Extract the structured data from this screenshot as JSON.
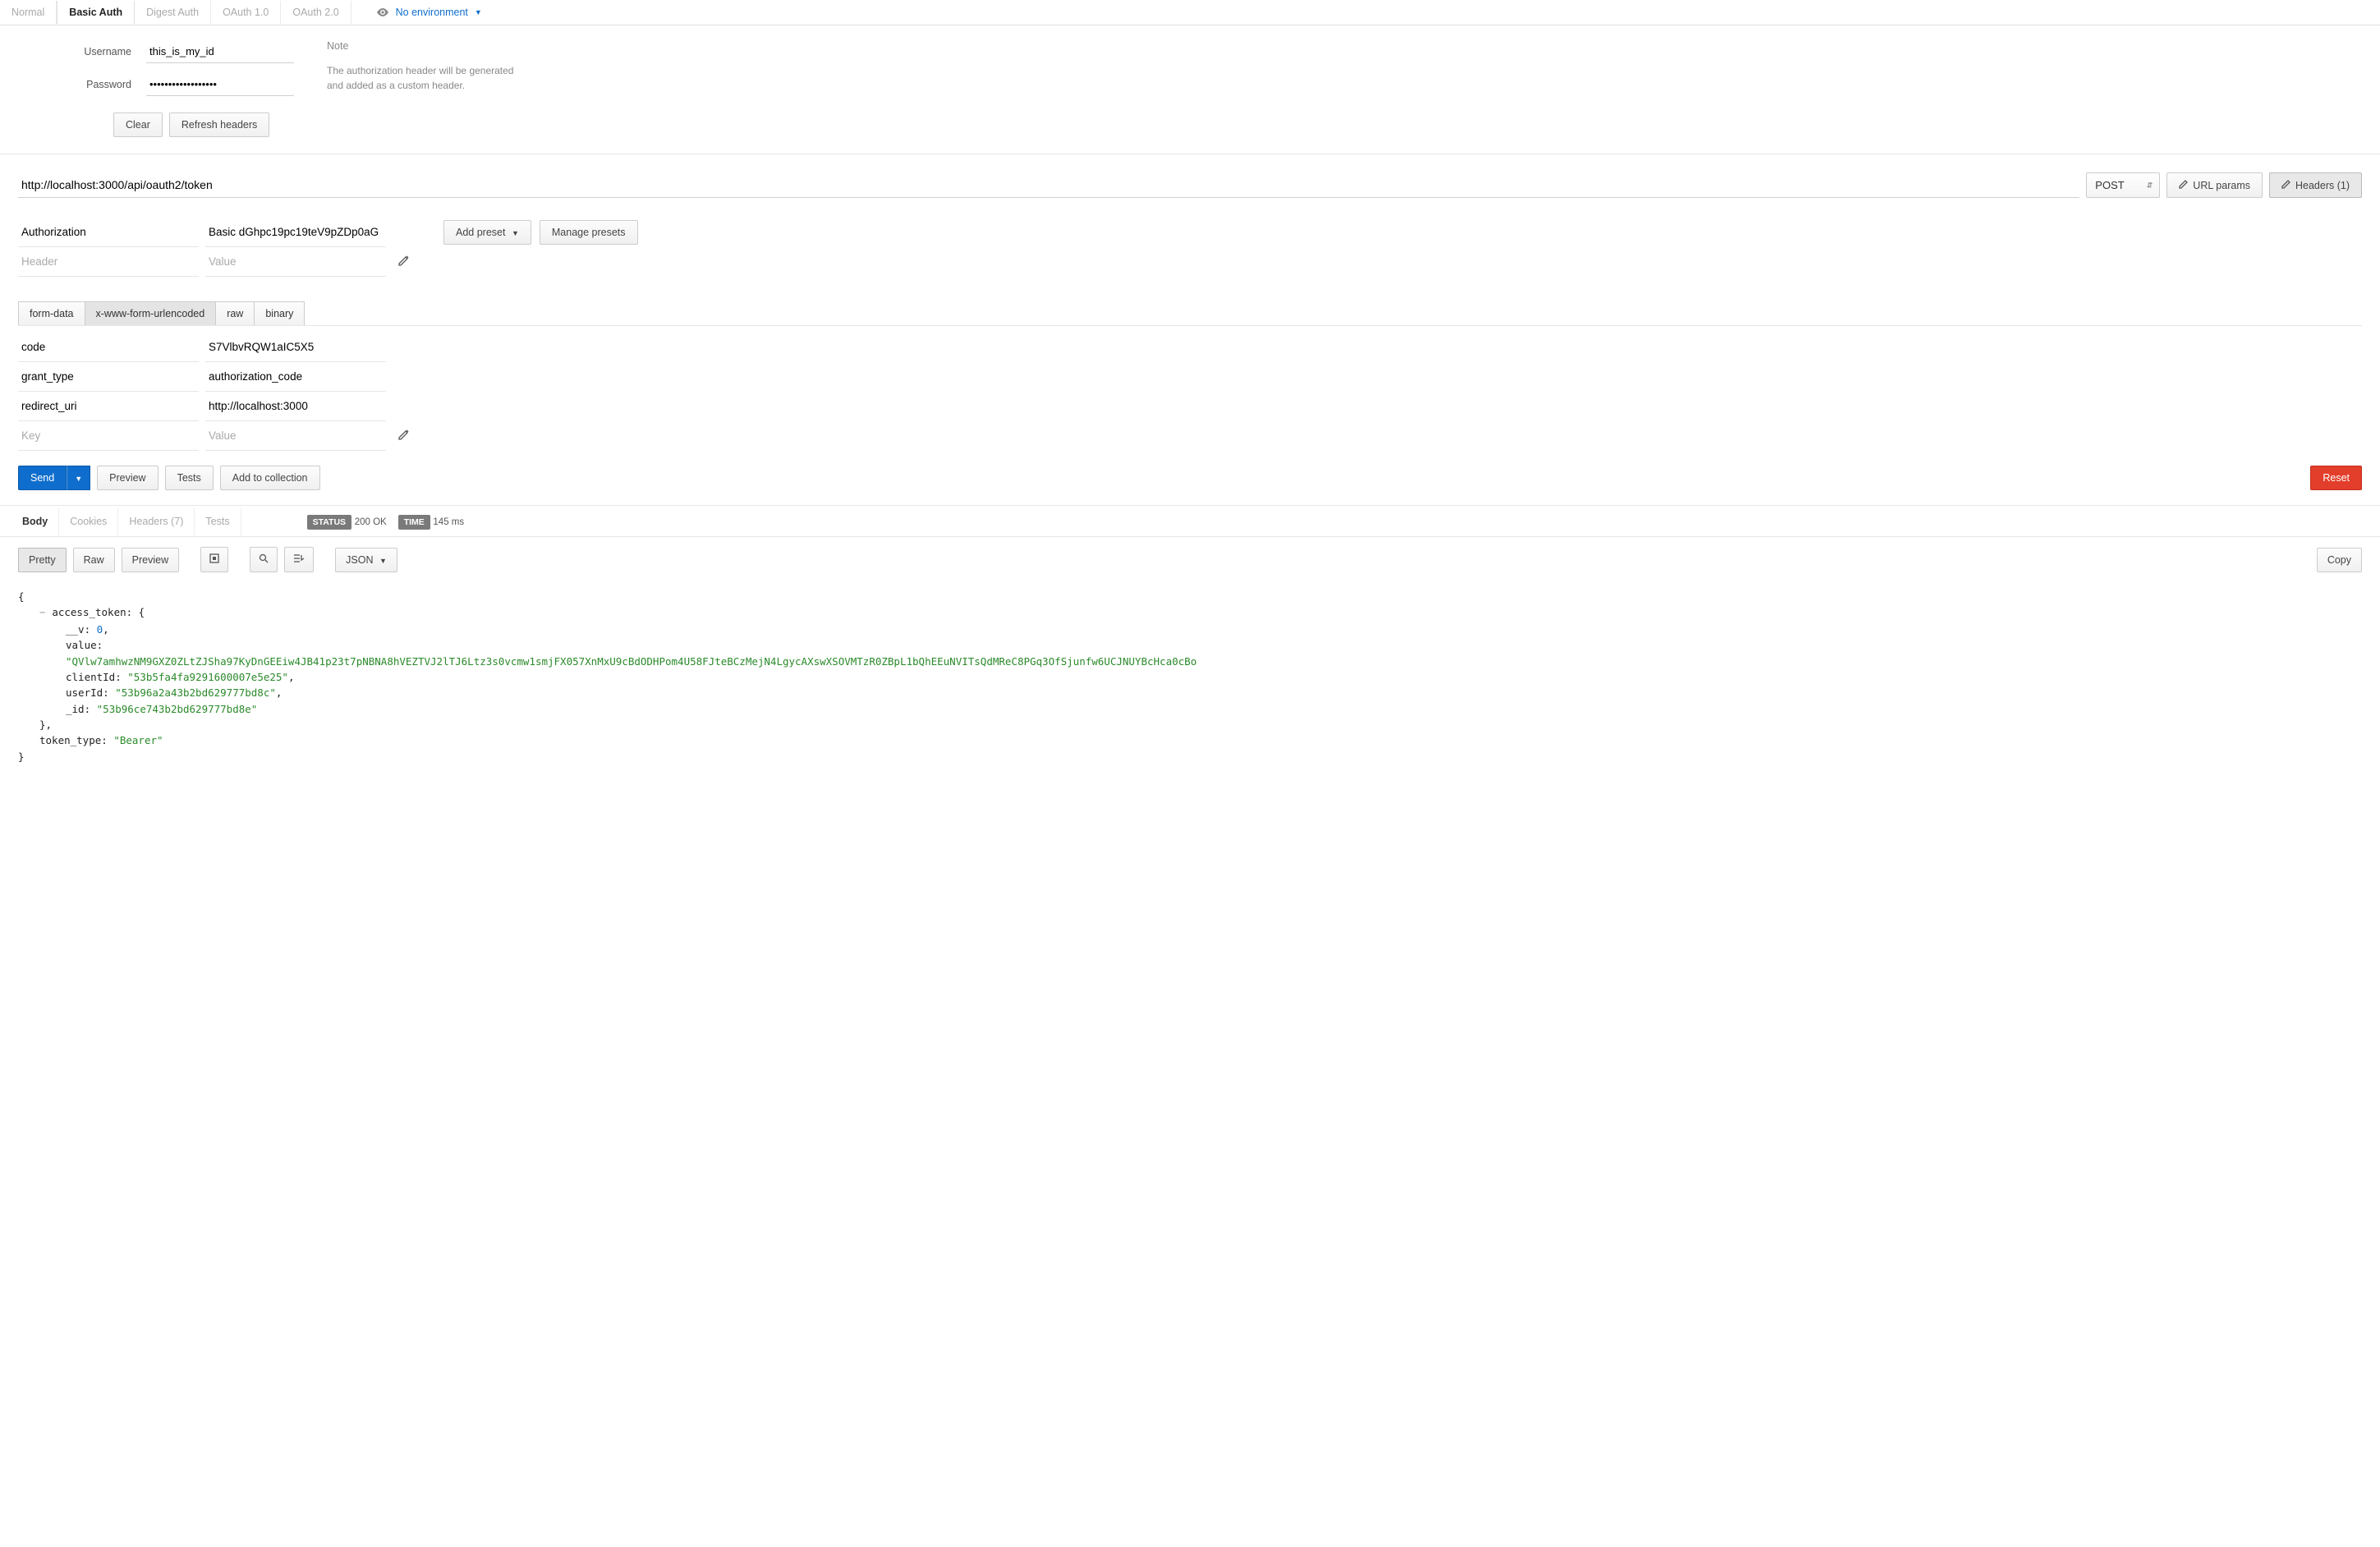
{
  "top_tabs": {
    "items": [
      "Normal",
      "Basic Auth",
      "Digest Auth",
      "OAuth 1.0",
      "OAuth 2.0"
    ],
    "active_index": 1
  },
  "environment": {
    "label": "No environment"
  },
  "auth": {
    "username_label": "Username",
    "username_value": "this_is_my_id",
    "password_label": "Password",
    "password_value": "••••••••••••••••••",
    "clear_label": "Clear",
    "refresh_label": "Refresh headers",
    "note_title": "Note",
    "note_text": "The authorization header will be generated and added as a custom header."
  },
  "request": {
    "url": "http://localhost:3000/api/oauth2/token",
    "method": "POST",
    "url_params_label": "URL params",
    "headers_btn_label": "Headers (1)"
  },
  "headers": {
    "rows": [
      {
        "key": "Authorization",
        "value": "Basic dGhpc19pc19teV9pZDp0aG"
      }
    ],
    "key_placeholder": "Header",
    "value_placeholder": "Value"
  },
  "presets": {
    "add_preset_label": "Add preset",
    "manage_presets_label": "Manage presets"
  },
  "body_tabs": {
    "items": [
      "form-data",
      "x-www-form-urlencoded",
      "raw",
      "binary"
    ],
    "active_index": 1
  },
  "body": {
    "rows": [
      {
        "key": "code",
        "value": "S7VlbvRQW1aIC5X5"
      },
      {
        "key": "grant_type",
        "value": "authorization_code"
      },
      {
        "key": "redirect_uri",
        "value": "http://localhost:3000"
      }
    ],
    "key_placeholder": "Key",
    "value_placeholder": "Value"
  },
  "actions": {
    "send_label": "Send",
    "preview_label": "Preview",
    "tests_label": "Tests",
    "add_collection_label": "Add to collection",
    "reset_label": "Reset"
  },
  "response": {
    "tabs": [
      "Body",
      "Cookies",
      "Headers (7)",
      "Tests"
    ],
    "active_index": 0,
    "status_label": "STATUS",
    "status_value": "200 OK",
    "time_label": "TIME",
    "time_value": "145 ms",
    "view_tabs": [
      "Pretty",
      "Raw",
      "Preview"
    ],
    "view_active_index": 0,
    "format_label": "JSON",
    "copy_label": "Copy"
  },
  "json": {
    "access_token_key": "access_token",
    "v_key": "__v",
    "v_val": "0",
    "value_key": "value",
    "value_val": "\"QVlw7amhwzNM9GXZ0ZLtZJSha97KyDnGEEiw4JB41p23t7pNBNA8hVEZTVJ2lTJ6Ltz3s0vcmw1smjFX057XnMxU9cBdODHPom4U58FJteBCzMejN4LgycAXswXSOVMTzR0ZBpL1bQhEEuNVITsQdMReC8PGq3OfSjunfw6UCJNUYBcHca0cBo",
    "clientId_key": "clientId",
    "clientId_val": "\"53b5fa4fa9291600007e5e25\"",
    "userId_key": "userId",
    "userId_val": "\"53b96a2a43b2bd629777bd8c\"",
    "id_key": "_id",
    "id_val": "\"53b96ce743b2bd629777bd8e\"",
    "token_type_key": "token_type",
    "token_type_val": "\"Bearer\""
  }
}
